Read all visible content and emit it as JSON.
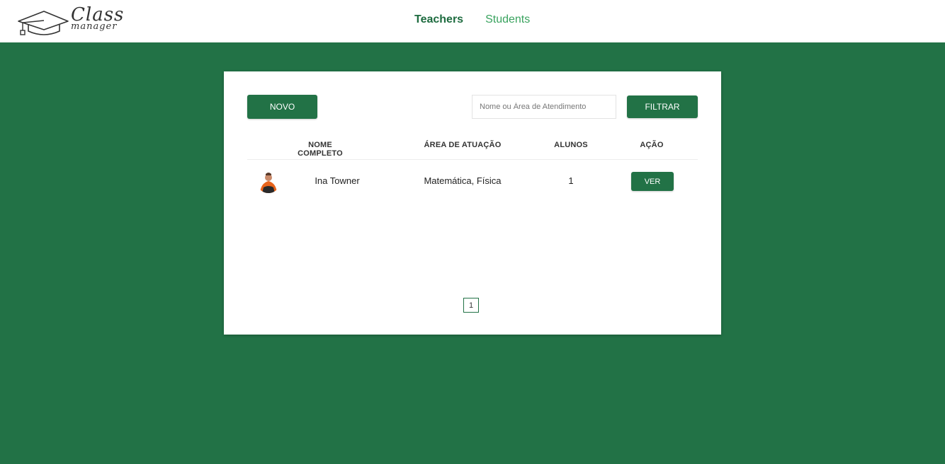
{
  "app": {
    "logo_line1": "Class",
    "logo_line2": "manager"
  },
  "nav": {
    "items": [
      {
        "label": "Teachers",
        "active": true
      },
      {
        "label": "Students",
        "active": false
      }
    ]
  },
  "toolbar": {
    "new_label": "NOVO",
    "search_placeholder": "Nome ou Área de Atendimento",
    "search_value": "",
    "filter_label": "FILTRAR"
  },
  "table": {
    "headers": [
      "NOME COMPLETO",
      "ÁREA DE ATUAÇÃO",
      "ALUNOS",
      "AÇÃO"
    ],
    "rows": [
      {
        "name": "Ina Towner",
        "area": "Matemática, Física",
        "students": "1",
        "action_label": "VER"
      }
    ]
  },
  "pagination": {
    "current_page": "1"
  },
  "colors": {
    "brand_green": "#227246",
    "nav_active": "#1d6b3f",
    "nav_inactive": "#3aa35f"
  }
}
